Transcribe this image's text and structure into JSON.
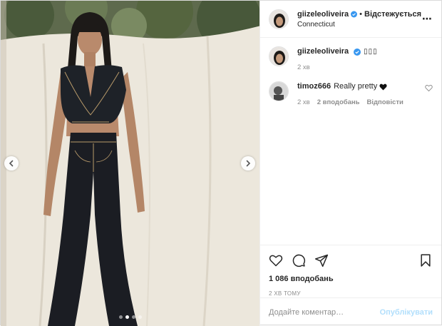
{
  "post": {
    "author": {
      "username": "giizeleoliveira",
      "follow_state": "Відстежується",
      "location": "Connecticut",
      "verified_icon": "verified-badge-icon"
    },
    "caption": {
      "username": "giizeleoliveira",
      "text": "▯▯▯",
      "time": "2 хв"
    },
    "comments": [
      {
        "username": "timoz666",
        "text": "Really pretty",
        "emoji_icon": "black-heart-icon",
        "time": "2 хв",
        "likes": "2 вподобань",
        "reply_label": "Відповісти"
      }
    ],
    "likes_count": "1 086 вподобань",
    "timestamp": "2 ХВ ТОМУ",
    "add_comment": {
      "placeholder": "Додайте коментар…",
      "post_label": "Опублікувати"
    },
    "carousel": {
      "slides": 4,
      "active_index": 2
    }
  },
  "colors": {
    "link_blue_disabled": "#b2dffc",
    "verified_blue": "#3897f0",
    "meta_gray": "#8e8e8e",
    "text": "#262626"
  }
}
